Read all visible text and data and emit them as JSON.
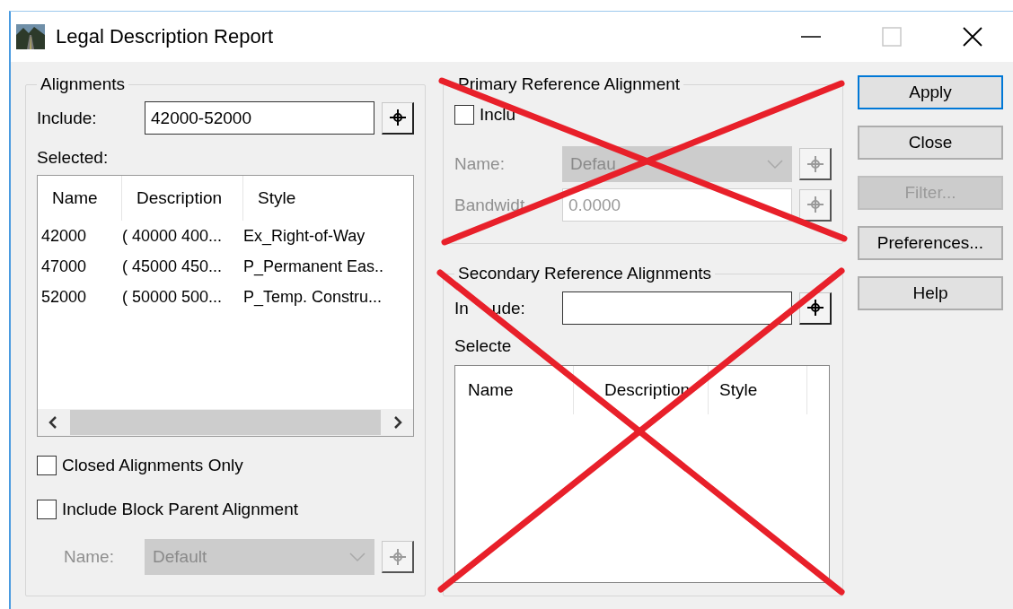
{
  "window": {
    "title": "Legal Description Report",
    "title_buttons": [
      {
        "kind": "minimize",
        "disabled": false
      },
      {
        "kind": "maximize",
        "disabled": true
      },
      {
        "kind": "close",
        "disabled": false
      }
    ]
  },
  "alignments": {
    "legend": "Alignments",
    "include_label": "Include:",
    "include_value": "42000-52000",
    "selected_label": "Selected:",
    "columns": [
      "Name",
      "Description",
      "Style"
    ],
    "rows": [
      {
        "name": "42000",
        "description": "( 40000 400...",
        "style": "Ex_Right-of-Way"
      },
      {
        "name": "47000",
        "description": "( 45000 450...",
        "style": "P_Permanent Eas.."
      },
      {
        "name": "52000",
        "description": "( 50000 500...",
        "style": "P_Temp. Constru..."
      }
    ],
    "checkboxes": [
      {
        "label": "Closed Alignments Only",
        "checked": false
      },
      {
        "label": "Include Block Parent Alignment",
        "checked": false
      }
    ],
    "name_label": "Name:",
    "name_value": "Default",
    "name_disabled": true
  },
  "primary": {
    "legend": "Primary Reference Alignment",
    "crossed_out": true,
    "include": {
      "label": "Inclu",
      "checked": false
    },
    "name_label": "Name:",
    "name_value": "Defau",
    "bandwidth_label": "Bandwidt",
    "bandwidth_value": "0.0000",
    "disabled": true
  },
  "secondary": {
    "legend": "Secondary Reference Alignments",
    "crossed_out": true,
    "include_label_parts": [
      "In",
      "ude:"
    ],
    "selected_label": "Selecte",
    "columns": [
      "Name",
      "Description",
      "Style"
    ]
  },
  "buttons": [
    {
      "label": "Apply",
      "default": true,
      "disabled": false
    },
    {
      "label": "Close",
      "default": false,
      "disabled": false
    },
    {
      "label": "Filter...",
      "default": false,
      "disabled": true
    },
    {
      "label": "Preferences...",
      "default": false,
      "disabled": false
    },
    {
      "label": "Help",
      "default": false,
      "disabled": false
    }
  ]
}
